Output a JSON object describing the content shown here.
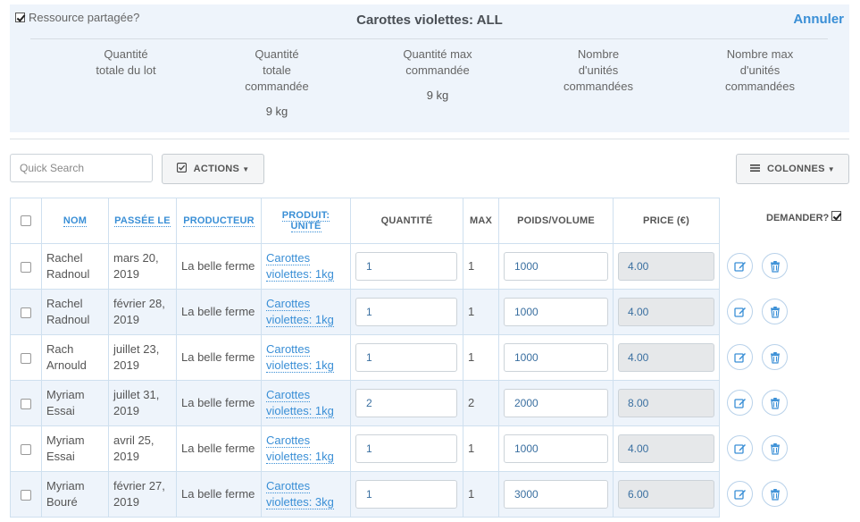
{
  "panel": {
    "shared_label": "Ressource partagée?",
    "title": "Carottes violettes: ALL",
    "cancel_label": "Annuler",
    "stats": [
      {
        "label": "Quantité\ntotale du lot",
        "value": ""
      },
      {
        "label": "Quantité\ntotale\ncommandée",
        "value": "9 kg"
      },
      {
        "label": "Quantité max\ncommandée",
        "value": "9 kg"
      },
      {
        "label": "Nombre\nd'unités\ncommandées",
        "value": ""
      },
      {
        "label": "Nombre max\nd'unités\ncommandées",
        "value": ""
      }
    ]
  },
  "toolbar": {
    "search_placeholder": "Quick Search",
    "actions_label": "ACTIONS",
    "columns_label": "COLONNES"
  },
  "table": {
    "headers": {
      "nom": "NOM",
      "passee": "PASSÉE LE",
      "producteur": "PRODUCTEUR",
      "produit": "PRODUIT:\nUNITÉ",
      "quantite": "QUANTITÉ",
      "max": "MAX",
      "poids": "POIDS/VOLUME",
      "price": "PRICE (€)"
    },
    "ask_label": "DEMANDER?",
    "rows": [
      {
        "nom": "Rachel Radnoul",
        "passee": "mars 20, 2019",
        "producteur": "La belle ferme",
        "produit": "Carottes violettes: 1kg",
        "quantite": "1",
        "max": "1",
        "poids": "1000",
        "price": "4.00"
      },
      {
        "nom": "Rachel Radnoul",
        "passee": "février 28, 2019",
        "producteur": "La belle ferme",
        "produit": "Carottes violettes: 1kg",
        "quantite": "1",
        "max": "1",
        "poids": "1000",
        "price": "4.00"
      },
      {
        "nom": "Rach Arnould",
        "passee": "juillet 23, 2019",
        "producteur": "La belle ferme",
        "produit": "Carottes violettes: 1kg",
        "quantite": "1",
        "max": "1",
        "poids": "1000",
        "price": "4.00"
      },
      {
        "nom": "Myriam Essai",
        "passee": "juillet 31, 2019",
        "producteur": "La belle ferme",
        "produit": "Carottes violettes: 1kg",
        "quantite": "2",
        "max": "2",
        "poids": "2000",
        "price": "8.00"
      },
      {
        "nom": "Myriam Essai",
        "passee": "avril 25, 2019",
        "producteur": "La belle ferme",
        "produit": "Carottes violettes: 1kg",
        "quantite": "1",
        "max": "1",
        "poids": "1000",
        "price": "4.00"
      },
      {
        "nom": "Myriam Bouré",
        "passee": "février 27, 2019",
        "producteur": "La belle ferme",
        "produit": "Carottes violettes: 3kg",
        "quantite": "1",
        "max": "1",
        "poids": "3000",
        "price": "6.00"
      }
    ]
  },
  "icons": {
    "edit": "edit-icon",
    "delete": "trash-icon",
    "actions": "check-square-icon",
    "columns": "list-icon"
  },
  "colors": {
    "accent": "#3a8fd6",
    "panel_bg": "#eef4fb"
  }
}
